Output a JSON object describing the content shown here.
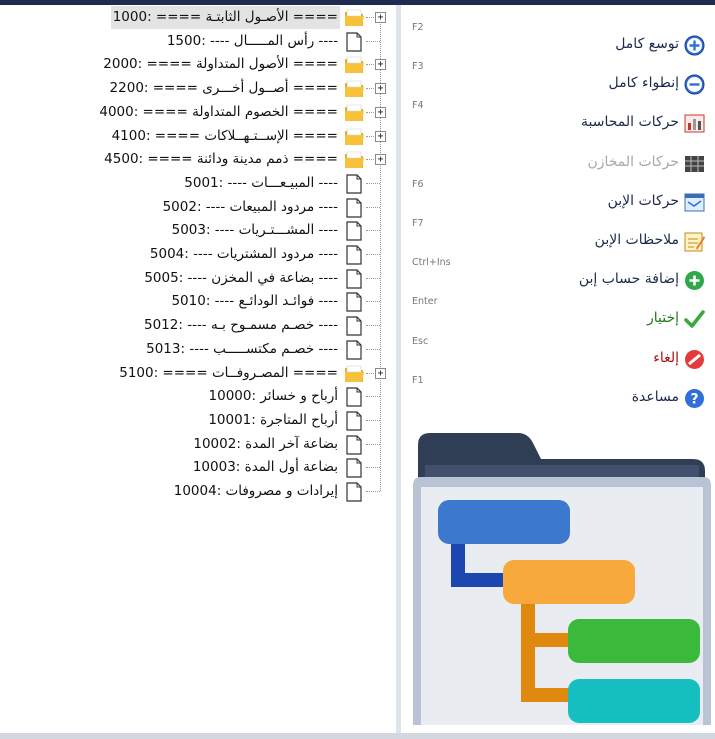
{
  "tree": {
    "nodes": [
      {
        "label": "==== الأصـول الثابتـة ==== :1000",
        "type": "folder",
        "selected": true
      },
      {
        "label": "---- رأس المـــــال ---- :1500",
        "type": "doc"
      },
      {
        "label": "==== الأصول المتداولة ==== :2000",
        "type": "folder"
      },
      {
        "label": "==== أصــول أخـــرى ==== :2200",
        "type": "folder"
      },
      {
        "label": "==== الخصوم المتداولة ==== :4000",
        "type": "folder"
      },
      {
        "label": "==== الإســتـهــلاكات ==== :4100",
        "type": "folder"
      },
      {
        "label": "==== ذمم مدينة ودائنة ==== :4500",
        "type": "folder"
      },
      {
        "label": "---- المبيـعـــات ---- :5001",
        "type": "doc"
      },
      {
        "label": "---- مردود المبيعات ---- :5002",
        "type": "doc"
      },
      {
        "label": "---- المشـــتـريات ---- :5003",
        "type": "doc"
      },
      {
        "label": "---- مردود المشتريات ---- :5004",
        "type": "doc"
      },
      {
        "label": "---- بضاعة في المخزن ---- :5005",
        "type": "doc"
      },
      {
        "label": "---- فوائـد الودائـع ---- :5010",
        "type": "doc"
      },
      {
        "label": "---- خصـم مسمـوح بـه ---- :5012",
        "type": "doc"
      },
      {
        "label": "---- خصـم مكتســـــب ---- :5013",
        "type": "doc"
      },
      {
        "label": "==== المصـروفــات ==== :5100",
        "type": "folder"
      },
      {
        "label": "أرباح و خسائر :10000",
        "type": "doc"
      },
      {
        "label": "أرباح المتاجرة :10001",
        "type": "doc"
      },
      {
        "label": "بضاعة آخر المدة :10002",
        "type": "doc"
      },
      {
        "label": "بضاعة أول المدة :10003",
        "type": "doc"
      },
      {
        "label": "إيرادات و مصروفات :10004",
        "type": "doc"
      }
    ]
  },
  "actions": [
    {
      "shortcut": "F2",
      "label": "توسع كامل",
      "icon": "expand-plus-icon",
      "style": "normal"
    },
    {
      "shortcut": "F3",
      "label": "إنطواء كامل",
      "icon": "collapse-minus-icon",
      "style": "normal"
    },
    {
      "shortcut": "F4",
      "label": "حركات المحاسبة",
      "icon": "accounting-chart-icon",
      "style": "normal"
    },
    {
      "shortcut": "",
      "label": "حركات المخازن",
      "icon": "warehouse-grid-icon",
      "style": "disabled"
    },
    {
      "shortcut": "F6",
      "label": "حركات الإبن",
      "icon": "child-window-icon",
      "style": "normal"
    },
    {
      "shortcut": "F7",
      "label": "ملاحظات الإبن",
      "icon": "notes-pencil-icon",
      "style": "normal"
    },
    {
      "shortcut": "Ctrl+Ins",
      "label": "إضافة حساب إبن",
      "icon": "add-green-icon",
      "style": "normal"
    },
    {
      "shortcut": "Enter",
      "label": "إختيار",
      "icon": "check-icon",
      "style": "ok"
    },
    {
      "shortcut": "Esc",
      "label": "إلغاء",
      "icon": "cancel-red-icon",
      "style": "cancel"
    },
    {
      "shortcut": "F1",
      "label": "مساعدة",
      "icon": "help-icon",
      "style": "normal"
    }
  ],
  "colors": {
    "folder": "#f7c23a",
    "tree_blue": "#3d78cf",
    "tree_orange": "#f7a93b",
    "tree_green": "#3ab93a",
    "tree_teal": "#17c0c0"
  }
}
